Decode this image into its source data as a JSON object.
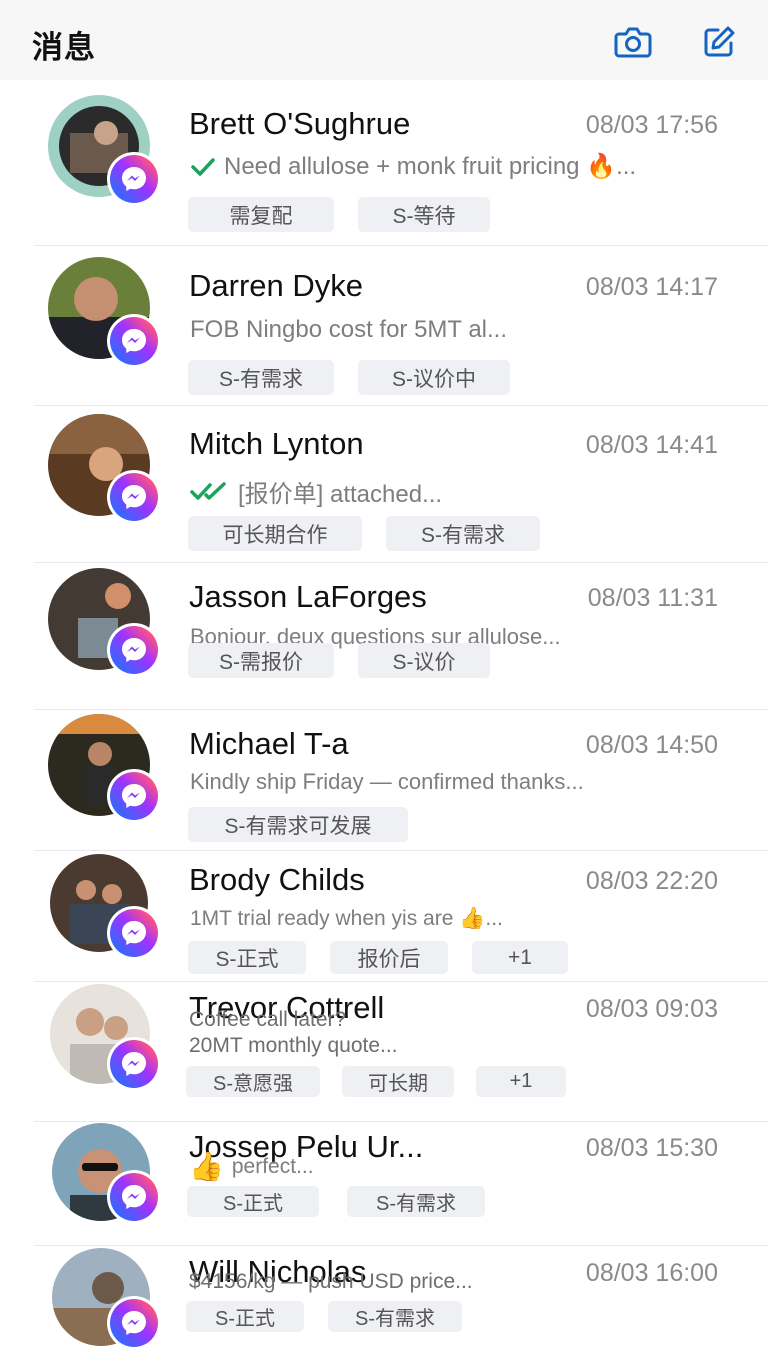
{
  "header": {
    "title": "消息",
    "camera_icon": "camera-icon",
    "compose_icon": "compose-icon"
  },
  "colors": {
    "accent": "#1565c0",
    "read_check": "#1aa35c",
    "tag_bg": "#eef0f4",
    "muted_text": "#8a8a8e"
  },
  "conversations": [
    {
      "name": "Brett O'Sughrue",
      "time": "08/03 17:56",
      "status_icon": "check-icon",
      "preview": "Need allulose + monk fruit pricing 🔥...",
      "tags": [
        "需复配",
        "S-等待"
      ]
    },
    {
      "name": "Darren Dyke",
      "time": "08/03 14:17",
      "preview": "FOB Ningbo cost for 5MT al...",
      "tags": [
        "S-有需求",
        "S-议价中"
      ]
    },
    {
      "name": "Mitch Lynton",
      "time": "08/03 14:41",
      "status_icon": "double-check-icon",
      "preview": "[报价单] attached...",
      "tags": [
        "可长期合作",
        "S-有需求"
      ]
    },
    {
      "name": "Jasson LaForges",
      "time": "08/03 11:31",
      "preview": "Bonjour, deux questions sur allulose...",
      "tags": [
        "S-需报价",
        "S-议价"
      ]
    },
    {
      "name": "Michael T-a",
      "time": "08/03 14:50",
      "preview": "Kindly ship Friday — confirmed thanks...",
      "tags": [
        "S-有需求可发展"
      ]
    },
    {
      "name": "Brody Childs",
      "time": "08/03 22:20",
      "preview": "1MT trial ready when yis are 👍...",
      "tags": [
        "S-正式",
        "报价后",
        "+1"
      ]
    },
    {
      "name": "Trevor Cottrell",
      "time": "08/03 09:03",
      "preview_lines": [
        "Coffee call later?",
        "20MT monthly quote..."
      ],
      "tags": [
        "S-意愿强",
        "可长期",
        "+1"
      ]
    },
    {
      "name": "Jossep Pelu Ur...",
      "time": "08/03 15:30",
      "status_icon": "thumbs-up-icon",
      "preview": "perfect...",
      "tags": [
        "S-正式",
        "S-有需求"
      ]
    },
    {
      "name": "Will Nicholas",
      "time": "08/03 16:00",
      "preview": "$4156/kg — push USD price...",
      "tags": [
        "S-正式",
        "S-有需求"
      ]
    }
  ]
}
